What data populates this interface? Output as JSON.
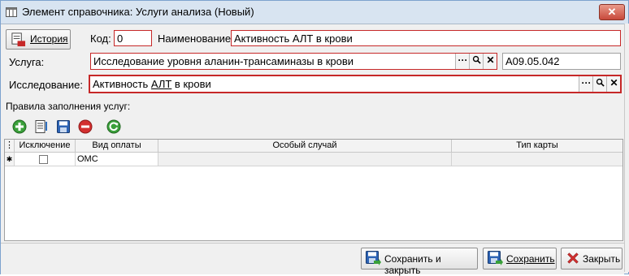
{
  "window": {
    "title": "Элемент справочника: Услуги анализа (Новый)"
  },
  "history_button": {
    "label": "История"
  },
  "form": {
    "code_label": "Код:",
    "code_value": "0",
    "name_label": "Наименование:",
    "name_value": "Активность АЛТ в крови",
    "service_label": "Услуга:",
    "service_value": "Исследование уровня аланин-трансаминазы в крови",
    "service_code": "A09.05.042",
    "study_label": "Исследование:",
    "study_value_pre": "Активность ",
    "study_value_u": "АЛТ",
    "study_value_post": " в крови",
    "ellipsis": "···"
  },
  "rules": {
    "label": "Правила заполнения услуг:",
    "columns": [
      "Исключение",
      "Вид оплаты",
      "Особый случай",
      "Тип карты"
    ],
    "rows": [
      {
        "exclusion": false,
        "payment_type": "ОМС",
        "special_case": "",
        "card_type": ""
      }
    ],
    "new_row_marker": "✱"
  },
  "footer": {
    "save_close": "Сохранить и закрыть",
    "save": "Сохранить",
    "close": "Закрыть"
  },
  "colors": {
    "required_border": "#c62828",
    "titlebar": "#d8e4f1"
  }
}
